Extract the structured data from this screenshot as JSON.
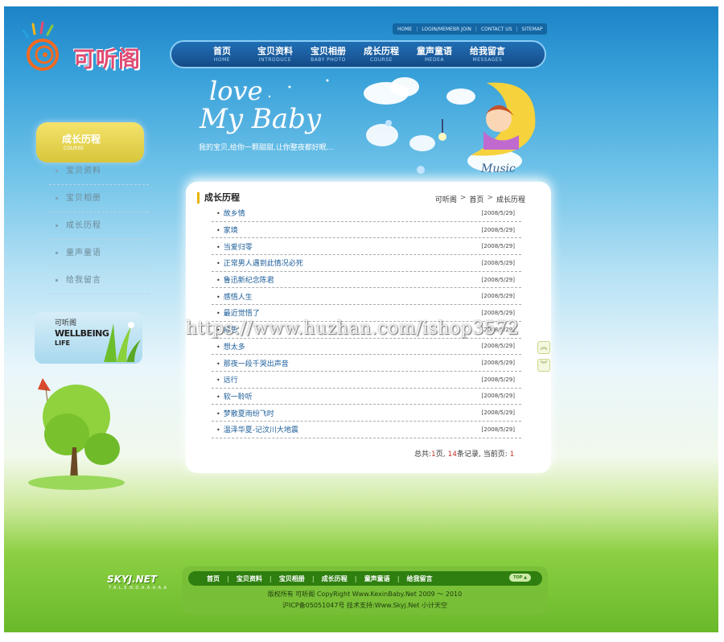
{
  "site": {
    "logo_text": "可听阁"
  },
  "top_links": [
    "HOME",
    "LOGIN/MEMEBR JOIN",
    "CONTACT US",
    "SITEMAP"
  ],
  "nav": [
    {
      "cn": "首页",
      "en": "HOME"
    },
    {
      "cn": "宝贝资料",
      "en": "INTRODUCE"
    },
    {
      "cn": "宝贝相册",
      "en": "BABY PHOTO"
    },
    {
      "cn": "成长历程",
      "en": "COURSE"
    },
    {
      "cn": "童声童语",
      "en": "MEDEA"
    },
    {
      "cn": "给我留言",
      "en": "MESSAGES"
    }
  ],
  "banner": {
    "love": "love",
    "my_baby": "My Baby",
    "slogan": "我的宝贝,给你一颗甜甜,让你整夜都好眠...",
    "music": "Music"
  },
  "sidebar": {
    "title_cn": "成长历程",
    "title_en": "COURSE",
    "items": [
      "宝贝资料",
      "宝贝相册",
      "成长历程",
      "童声童语",
      "给我留言"
    ],
    "card": {
      "line1": "可听阁",
      "line2": "WELLBEING",
      "line3": "LIFE"
    }
  },
  "content": {
    "section_title": "成长历程",
    "breadcrumb": [
      "可听阁",
      "首页",
      "成长历程"
    ],
    "articles": [
      {
        "title": "故乡情",
        "date": "[2008/5/29]"
      },
      {
        "title": "家境",
        "date": "[2008/5/29]"
      },
      {
        "title": "当爱归零",
        "date": "[2008/5/29]"
      },
      {
        "title": "正常男人遇到此情况必死",
        "date": "[2008/5/29]"
      },
      {
        "title": "鲁迅新纪念陈君",
        "date": "[2008/5/29]"
      },
      {
        "title": "感悟人生",
        "date": "[2008/5/29]"
      },
      {
        "title": "最近觉悟了",
        "date": "[2008/5/29]"
      },
      {
        "title": "静思",
        "date": "[2008/5/29]"
      },
      {
        "title": "想太多",
        "date": "[2008/5/29]"
      },
      {
        "title": "那夜一段千哭出声音",
        "date": "[2008/5/29]"
      },
      {
        "title": "远行",
        "date": "[2008/5/29]"
      },
      {
        "title": "软一聆听",
        "date": "[2008/5/29]"
      },
      {
        "title": "梦散夏雨纷飞时",
        "date": "[2008/5/29]"
      },
      {
        "title": "温泽华夏-记汶川大地震",
        "date": "[2008/5/29]"
      }
    ],
    "pager": {
      "prefix": "总共:",
      "pages": "1",
      "mid1": "页, ",
      "records": "14",
      "mid2": "条记录, 当前页: ",
      "current": "1"
    }
  },
  "watermark": "https://www.huzhan.com/ishop3572",
  "footer": {
    "logo": "SKYJ.NET",
    "logo_sub": "T.A.L.E.N.D.A.A.A.A.A",
    "nav": [
      "首页",
      "宝贝资料",
      "宝贝相册",
      "成长历程",
      "童声童语",
      "给我留言"
    ],
    "top": "TOP ▲",
    "copyright": "版权所有 可听阁 CopyRight Www.KexinBaby.Net 2009 ～ 2010",
    "icp": "沪ICP备05051047号 技术支持:Www.Skyj.Net 小计天空"
  },
  "colors": {
    "nav_bg": "#1b5c9e",
    "link_blue": "#1b5c99",
    "pager_red": "#c0392b",
    "footer_green": "#2e7f0f",
    "accent_yellow": "#e6b400"
  }
}
